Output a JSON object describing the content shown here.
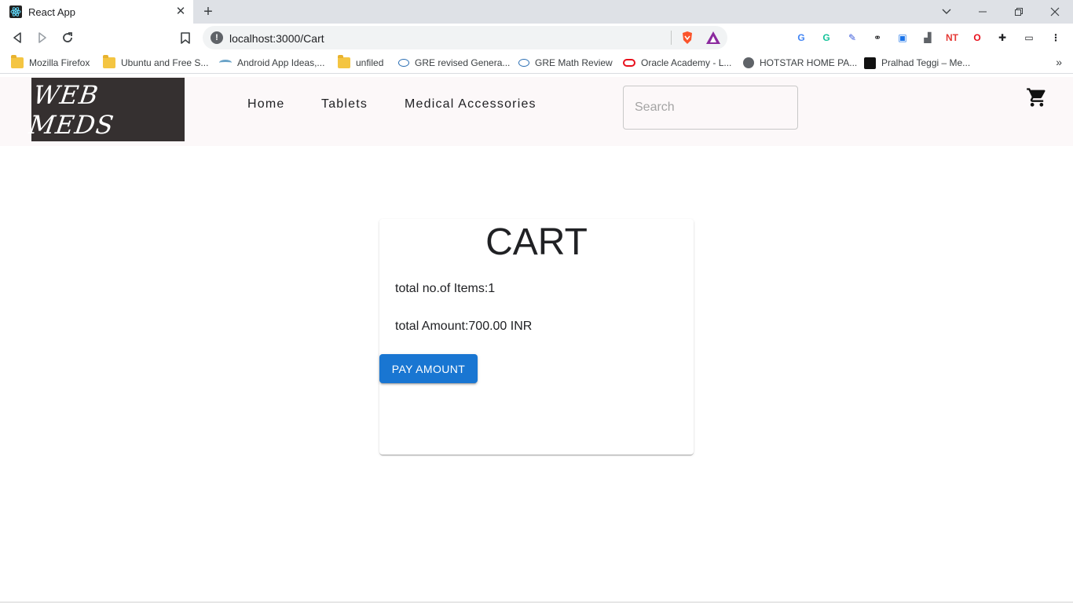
{
  "browser": {
    "tab_title": "React App",
    "tab_close": "✕",
    "new_tab": "+",
    "url": "localhost:3000/Cart",
    "bookmarks": [
      {
        "label": "Mozilla Firefox",
        "icon": "folder-icon"
      },
      {
        "label": "Ubuntu and Free S...",
        "icon": "folder-icon"
      },
      {
        "label": "Android App Ideas,...",
        "icon": "site-icon"
      },
      {
        "label": "unfiled",
        "icon": "folder-icon"
      },
      {
        "label": "GRE revised Genera...",
        "icon": "ets-icon"
      },
      {
        "label": "GRE Math Review",
        "icon": "ets-icon"
      },
      {
        "label": "Oracle Academy - L...",
        "icon": "oracle-icon"
      },
      {
        "label": "HOTSTAR HOME PA...",
        "icon": "globe-icon"
      },
      {
        "label": "Pralhad Teggi – Me...",
        "icon": "medium-icon"
      }
    ],
    "bookmarks_more": "»",
    "extensions": [
      {
        "name": "translate-icon",
        "text": "G",
        "color": "#4285f4"
      },
      {
        "name": "grammarly-icon",
        "text": "G",
        "color": "#15c39a"
      },
      {
        "name": "pen-icon",
        "text": "✎",
        "color": "#3b5bdb"
      },
      {
        "name": "link-icon",
        "text": "⚭",
        "color": "#202124"
      },
      {
        "name": "screen-icon",
        "text": "▣",
        "color": "#1a73e8"
      },
      {
        "name": "stats-icon",
        "text": "▟",
        "color": "#5f6368"
      },
      {
        "name": "nt-icon",
        "text": "NT",
        "color": "#e53935"
      },
      {
        "name": "opera-icon",
        "text": "O",
        "color": "#e8101c"
      },
      {
        "name": "puzzle-icon",
        "text": "✚",
        "color": "#202124"
      },
      {
        "name": "wallet-icon",
        "text": "▭",
        "color": "#202124"
      },
      {
        "name": "menu-icon",
        "text": "⋮",
        "color": "#202124"
      }
    ]
  },
  "header": {
    "logo": "WEB MEDS",
    "nav": [
      "Home",
      "Tablets",
      "Medical Accessories"
    ],
    "search_placeholder": "Search"
  },
  "cart": {
    "title": "CART",
    "items_line": "total no.of Items:1",
    "amount_line": "total Amount:700.00 INR",
    "pay_button": "PAY AMOUNT"
  },
  "colors": {
    "primary_button": "#1976d2",
    "logo_background": "#353030",
    "header_background": "#fcf8f9"
  }
}
